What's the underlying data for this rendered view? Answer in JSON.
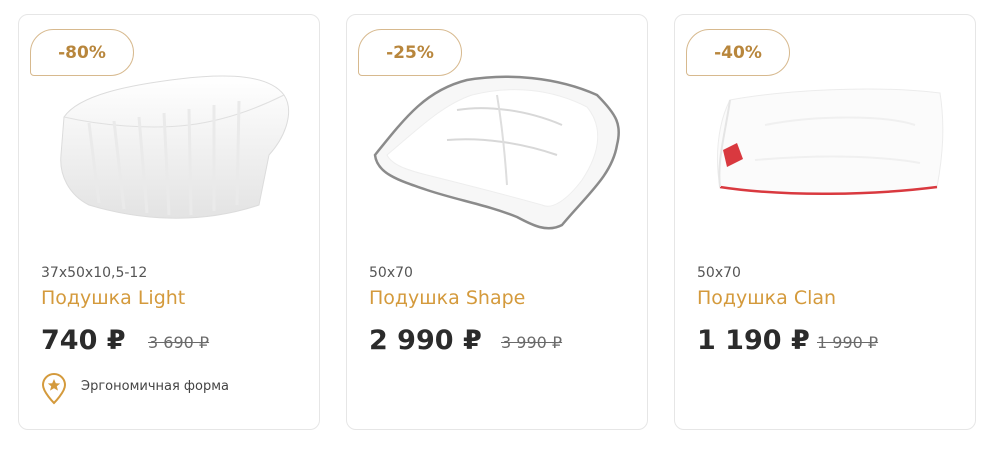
{
  "colors": {
    "accent": "#d49a3c",
    "badge_border": "#d7b98e",
    "price": "#2b2b2b",
    "card_border": "#e6e6e6"
  },
  "products": [
    {
      "discount": "-80%",
      "size": "37x50x10,5-12",
      "name": "Подушка Light",
      "price": "740 ₽",
      "old_price": "3 690 ₽",
      "feature_icon": "star-pin-icon",
      "feature": "Эргономичная форма"
    },
    {
      "discount": "-25%",
      "size": "50x70",
      "name": "Подушка Shape",
      "price": "2 990 ₽",
      "old_price": "3 990 ₽"
    },
    {
      "discount": "-40%",
      "size": "50x70",
      "name": "Подушка Clan",
      "price": "1 190 ₽",
      "old_price": "1 990 ₽"
    }
  ]
}
